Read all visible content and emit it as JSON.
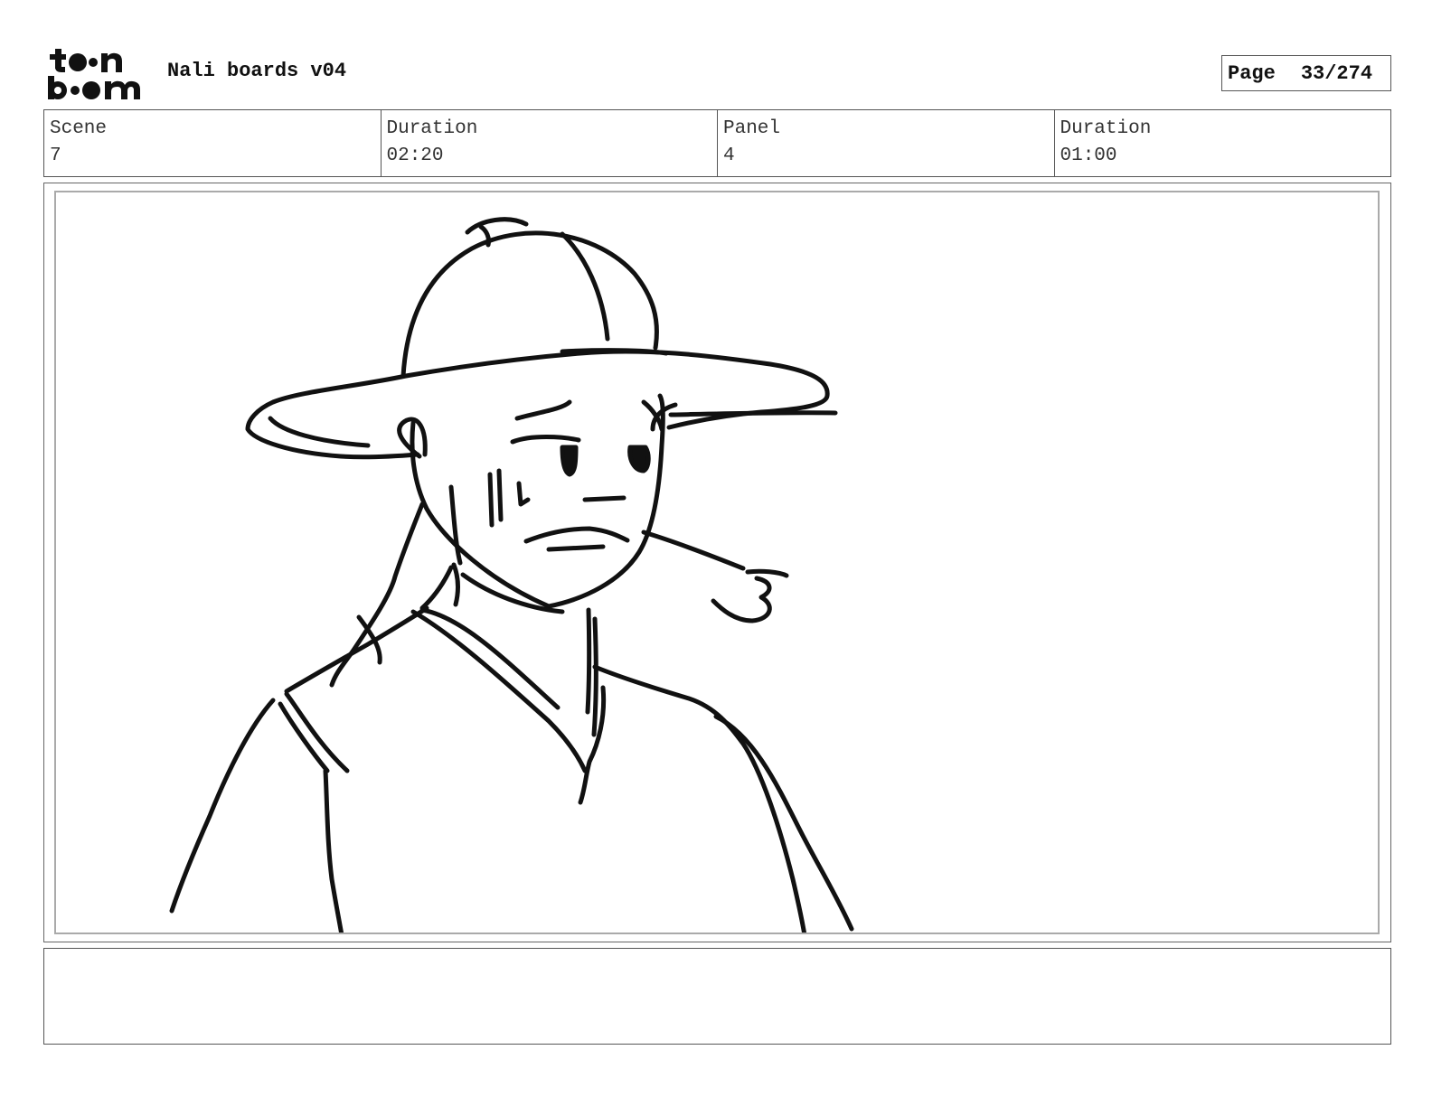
{
  "logo": {
    "line1": "toon",
    "line2": "boom"
  },
  "document": {
    "title": "Nali boards v04"
  },
  "page": {
    "label": "Page",
    "value": "33/274"
  },
  "info": [
    {
      "label": "Scene",
      "value": "7"
    },
    {
      "label": "Duration",
      "value": "02:20"
    },
    {
      "label": "Panel",
      "value": "4"
    },
    {
      "label": "Duration",
      "value": "01:00"
    }
  ],
  "notes": {
    "text": ""
  }
}
